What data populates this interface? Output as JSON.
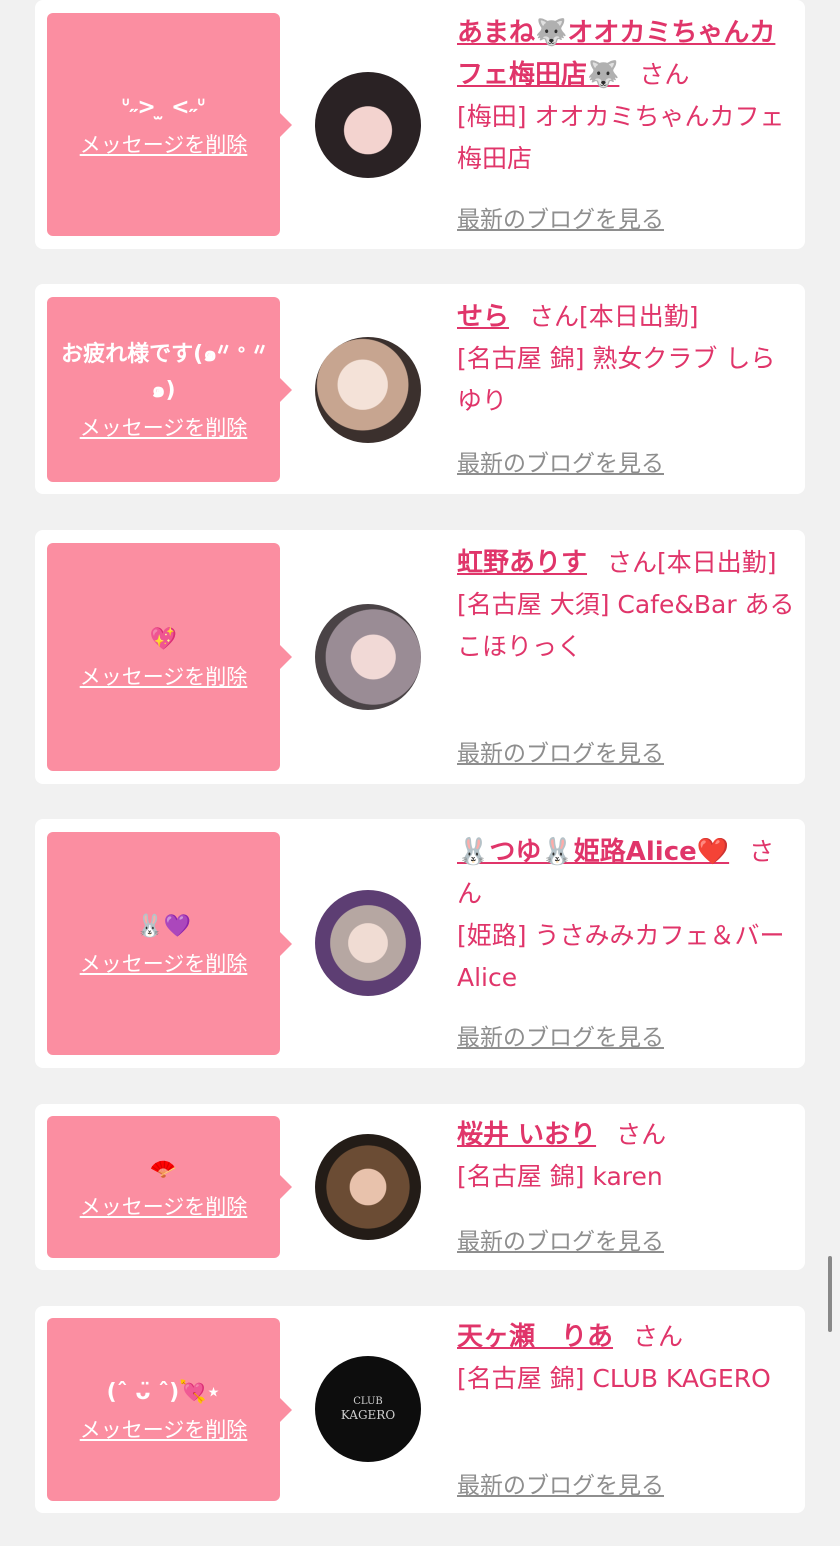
{
  "colors": {
    "bubble": "#fb8ea1",
    "accent": "#e0356a",
    "link_gray": "#8e8e8e",
    "background": "#f1f1f1"
  },
  "cards": [
    {
      "message": "ᐡ˶> ̫ <˶ᐡ",
      "delete_label": "メッセージを削除",
      "name": "あまね🐺オオカミちゃんカフェ梅田店🐺",
      "suffix": "さん",
      "shop": "[梅田] オオカミちゃんカフェ梅田店",
      "blog_label": "最新のブログを見る"
    },
    {
      "message": "お疲れ様です(๑ᐥ ᐤ ᐥ๑)",
      "delete_label": "メッセージを削除",
      "name": "せら",
      "suffix": "さん[本日出勤]",
      "shop": "[名古屋 錦] 熟女クラブ しらゆり",
      "blog_label": "最新のブログを見る"
    },
    {
      "message": "💖",
      "delete_label": "メッセージを削除",
      "name": "虹野ありす",
      "suffix": "さん[本日出勤]",
      "shop": "[名古屋 大須] Cafe&Bar あるこほりっく",
      "blog_label": "最新のブログを見る"
    },
    {
      "message": "🐰💜",
      "delete_label": "メッセージを削除",
      "name": "🐰つゆ🐰姫路Alice❤️",
      "suffix": "さん",
      "shop": "[姫路] うさみみカフェ＆バー　Alice",
      "blog_label": "最新のブログを見る"
    },
    {
      "message": "🪭",
      "delete_label": "メッセージを削除",
      "name": "桜井 いおり",
      "suffix": "さん",
      "shop": "[名古屋 錦] karen",
      "blog_label": "最新のブログを見る"
    },
    {
      "message": "(ˆ ᴗ̈ ˆ)💘⋆",
      "delete_label": "メッセージを削除",
      "name": "天ヶ瀬　りあ",
      "suffix": "さん",
      "shop": "[名古屋 錦] CLUB KAGERO",
      "blog_label": "最新のブログを見る"
    }
  ],
  "avatar_logo": {
    "line1": "CLUB",
    "line2": "KAGERO"
  }
}
